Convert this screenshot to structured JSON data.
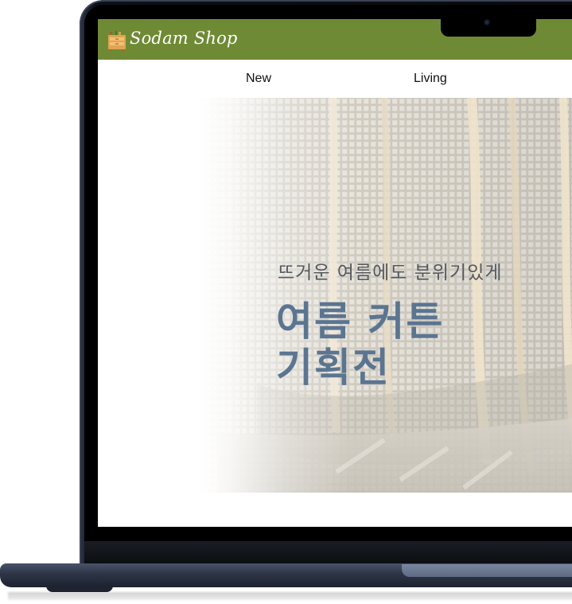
{
  "site": {
    "brand": "Sodam Shop",
    "header_color": "#6f8a35"
  },
  "nav": {
    "items": [
      {
        "label": "New"
      },
      {
        "label": "Living"
      }
    ]
  },
  "hero": {
    "subtitle": "뜨거운 여름에도 분위기있게",
    "title_line1": "여름 커튼",
    "title_line2": "기획전",
    "title_color": "#5b7591"
  },
  "icons": {
    "logo": "drawer-cabinet-icon"
  }
}
